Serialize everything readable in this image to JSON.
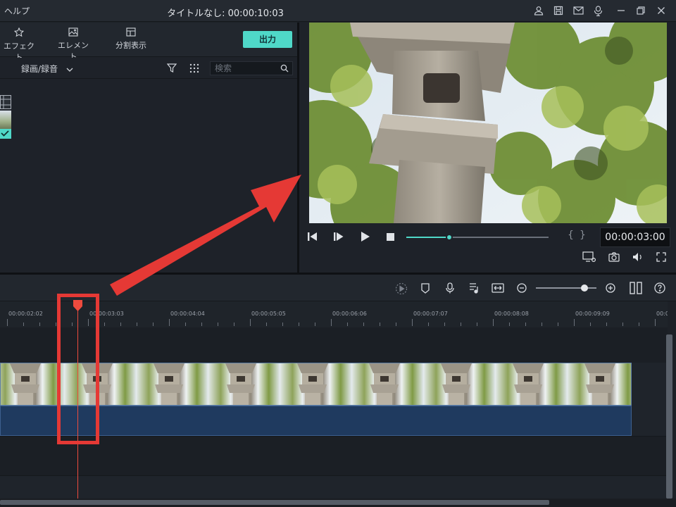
{
  "titlebar": {
    "menu_help": "ヘルプ",
    "project_title": "タイトルなし: 00:00:10:03",
    "icons": [
      "user-icon",
      "save-icon",
      "mail-icon",
      "download-icon",
      "minimize-icon",
      "restore-icon",
      "close-icon"
    ]
  },
  "media_panel": {
    "tabs": [
      {
        "label": "エフェクト",
        "icon": "effects-icon"
      },
      {
        "label": "エレメント",
        "icon": "elements-icon"
      },
      {
        "label": "分割表示",
        "icon": "split-screen-icon"
      }
    ],
    "export_label": "出力",
    "source_dropdown": "録画/録音",
    "search": {
      "placeholder": "検索",
      "value": ""
    }
  },
  "preview": {
    "timecode": "00:00:03:00",
    "progress_fraction": 0.3,
    "bracket_in": "{",
    "bracket_out": "}"
  },
  "timeline": {
    "ruler_labels": [
      "00:00:02:02",
      "00:00:03:03",
      "00:00:04:04",
      "00:00:05:05",
      "00:00:06:06",
      "00:00:07:07",
      "00:00:08:08",
      "00:00:09:09",
      "00:0"
    ],
    "zoom_fraction": 0.8
  },
  "annotation": {
    "color": "#e53935"
  },
  "colors": {
    "accent": "#4fd8c8",
    "playhead": "#ee4b3e",
    "audio_track": "#1f3a5f"
  }
}
